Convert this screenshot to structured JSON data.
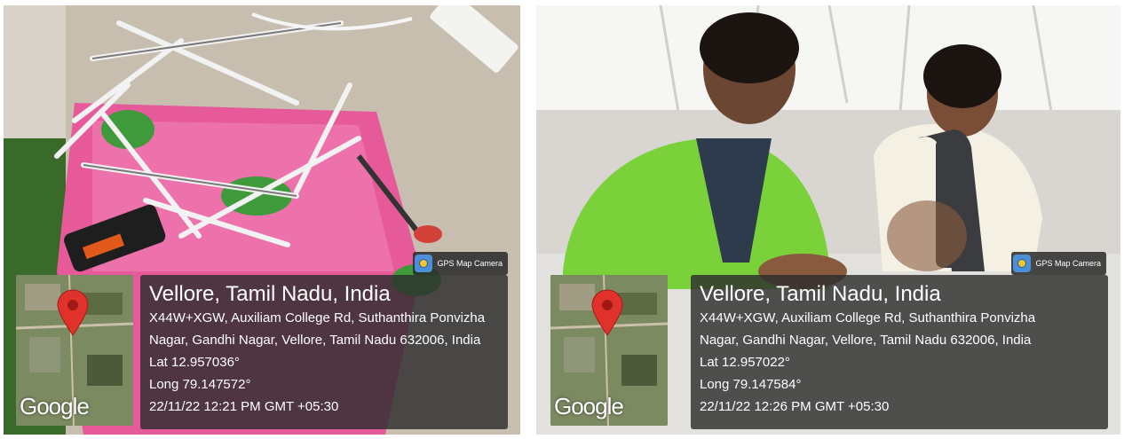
{
  "photos": [
    {
      "badge": {
        "icon": "gps-map-camera-icon",
        "label": "GPS Map Camera"
      },
      "map": {
        "logo": "Google",
        "icon": "location-pin-icon"
      },
      "location": {
        "title": "Vellore, Tamil Nadu, India",
        "address_line1": "X44W+XGW, Auxiliam College Rd, Suthanthira Ponvizha",
        "address_line2": "Nagar, Gandhi Nagar, Vellore, Tamil Nadu 632006, India",
        "lat": "Lat 12.957036°",
        "long": "Long 79.147572°",
        "timestamp": "22/11/22 12:21 PM GMT +05:30"
      }
    },
    {
      "badge": {
        "icon": "gps-map-camera-icon",
        "label": "GPS Map Camera"
      },
      "map": {
        "logo": "Google",
        "icon": "location-pin-icon"
      },
      "location": {
        "title": "Vellore, Tamil Nadu, India",
        "address_line1": "X44W+XGW, Auxiliam College Rd, Suthanthira Ponvizha",
        "address_line2": "Nagar, Gandhi Nagar, Vellore, Tamil Nadu 632006, India",
        "lat": "Lat 12.957022°",
        "long": "Long 79.147584°",
        "timestamp": "22/11/22 12:26 PM GMT +05:30"
      }
    }
  ],
  "colors": {
    "pin": "#e0322a",
    "overlay": "#2d2d2d",
    "cloth_pink": "#e65a9a",
    "kurta_green": "#7bd13a"
  }
}
